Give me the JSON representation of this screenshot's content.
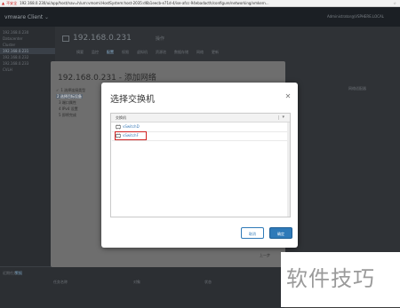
{
  "browser": {
    "warning_label": "不安全",
    "url": "192.168.0.230/ui/app/host/nav=h/urn:vmomi:HostSystem:host-2035:d6b1eecb-e71d-4/ise-afcc-94ebadacth/configure/networking/vmkern..."
  },
  "header": {
    "brand": "vmware Client",
    "user": "Administrator@VSPHERE.LOCAL"
  },
  "sidebar": {
    "items": [
      "192.168.0.230",
      "Datacenter",
      "Cluster",
      "192.168.0.231",
      "192.168.0.232",
      "192.168.0.233",
      "CVLH"
    ]
  },
  "page": {
    "host": "192.168.0.231",
    "actions": "操作",
    "tabs": [
      "摘要",
      "监控",
      "配置",
      "权限",
      "虚拟机",
      "资源池",
      "数据存储",
      "网络",
      "更新"
    ],
    "right_label": "网络适配器",
    "bottom": {
      "tasks_label": "近期任务",
      "alarms_label": "警报",
      "col1": "任务名称",
      "col2": "对象",
      "col3": "状态"
    }
  },
  "wizard": {
    "title": "192.168.0.231 - 添加网络",
    "steps": [
      {
        "label": "1 选择连接类型",
        "state": "done"
      },
      {
        "label": "2 选择目标设备",
        "state": "current"
      },
      {
        "label": "3 端口属性",
        "state": "pending"
      },
      {
        "label": "4 IPv4 设置",
        "state": "pending"
      },
      {
        "label": "5 即将完成",
        "state": "pending"
      }
    ],
    "footer_button": "上一步"
  },
  "dialog": {
    "title": "选择交换机",
    "grid": {
      "column": "交换机",
      "rows": [
        {
          "label": "vSwitchD",
          "selected": false
        },
        {
          "label": "vSwitchF",
          "selected": true
        }
      ]
    },
    "cancel_label": "取消",
    "ok_label": "确定"
  },
  "watermark": "软件技巧",
  "colors": {
    "accent": "#2f7ab8",
    "highlight": "#d12020"
  }
}
